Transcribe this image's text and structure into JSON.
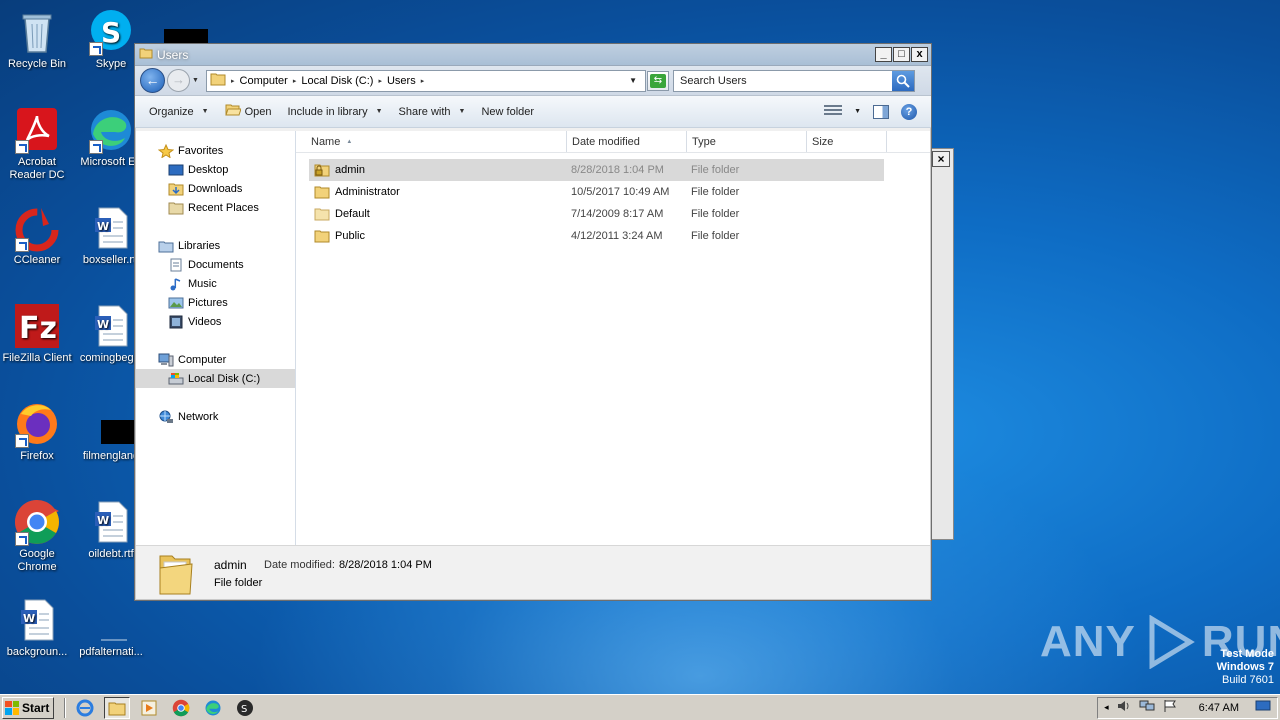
{
  "desktop": {
    "icons": [
      {
        "label": "Recycle Bin",
        "icon": "recycle-bin-icon"
      },
      {
        "label": "Skype",
        "icon": "skype-icon"
      },
      {
        "label": "Acrobat Reader DC",
        "icon": "acrobat-icon"
      },
      {
        "label": "Microsoft Edge",
        "icon": "edge-icon"
      },
      {
        "label": "CCleaner",
        "icon": "ccleaner-icon"
      },
      {
        "label": "boxseller.rtf",
        "icon": "word-doc-icon"
      },
      {
        "label": "FileZilla Client",
        "icon": "filezilla-icon"
      },
      {
        "label": "comingbegin",
        "icon": "word-doc-icon"
      },
      {
        "label": "Firefox",
        "icon": "firefox-icon"
      },
      {
        "label": "filmengland",
        "icon": "file-icon"
      },
      {
        "label": "Google Chrome",
        "icon": "chrome-icon"
      },
      {
        "label": "oildebt.rtf",
        "icon": "word-doc-icon"
      },
      {
        "label": "backgroun...",
        "icon": "word-doc-icon"
      },
      {
        "label": "pdfalternati...",
        "icon": "file-icon"
      }
    ],
    "watermark": {
      "line1": "Test Mode",
      "line2": "Windows 7",
      "line3": "Build 7601"
    },
    "anyrun": {
      "left": "ANY",
      "right": "RUN"
    }
  },
  "window": {
    "title": "Users",
    "minimize": "_",
    "maximize": "□",
    "close": "x",
    "address": [
      "Computer",
      "Local Disk (C:)",
      "Users"
    ],
    "search_placeholder": "Search Users",
    "toolbar": {
      "organize": "Organize",
      "open": "Open",
      "include_in_library": "Include in library",
      "share_with": "Share with",
      "new_folder": "New folder"
    },
    "nav": {
      "favorites": "Favorites",
      "desktop": "Desktop",
      "downloads": "Downloads",
      "recent_places": "Recent Places",
      "libraries": "Libraries",
      "documents": "Documents",
      "music": "Music",
      "pictures": "Pictures",
      "videos": "Videos",
      "computer": "Computer",
      "local_disk": "Local Disk (C:)",
      "network": "Network"
    },
    "columns": {
      "name": "Name",
      "date_modified": "Date modified",
      "type": "Type",
      "size": "Size"
    },
    "files": [
      {
        "name": "admin",
        "date": "8/28/2018 1:04 PM",
        "type": "File folder",
        "selected": true
      },
      {
        "name": "Administrator",
        "date": "10/5/2017 10:49 AM",
        "type": "File folder",
        "selected": false
      },
      {
        "name": "Default",
        "date": "7/14/2009 8:17 AM",
        "type": "File folder",
        "selected": false
      },
      {
        "name": "Public",
        "date": "4/12/2011 3:24 AM",
        "type": "File folder",
        "selected": false
      }
    ],
    "details": {
      "name": "admin",
      "date_label": "Date modified:",
      "date_value": "8/28/2018 1:04 PM",
      "type": "File folder"
    }
  },
  "taskbar": {
    "start": "Start",
    "clock": "6:47 AM"
  },
  "colors": {
    "desktop_blue": "#0e6cc4",
    "selection_gray": "#d9d9d9",
    "taskbar": "#d4d0c8"
  }
}
